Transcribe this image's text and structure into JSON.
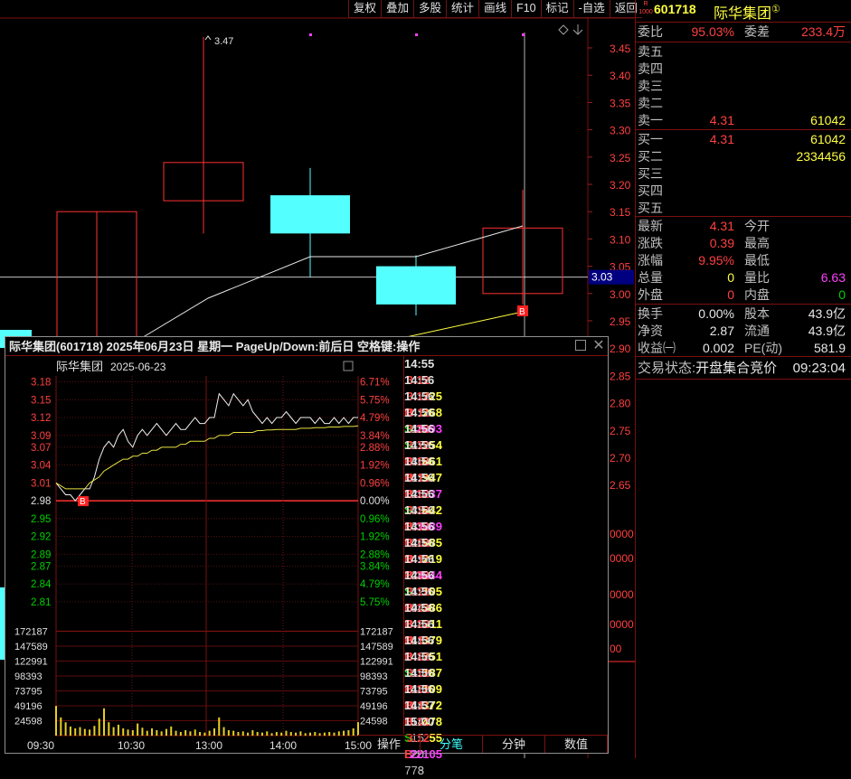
{
  "toolbar": [
    "复权",
    "叠加",
    "多股",
    "统计",
    "画线",
    "F10",
    "标记",
    "-自选",
    "返回"
  ],
  "main_chart": {
    "price_axis": [
      "3.45",
      "3.40",
      "3.35",
      "3.30",
      "3.25",
      "3.20",
      "3.15",
      "3.10",
      "3.05",
      "3.00",
      "2.95",
      "2.90",
      "2.85",
      "2.80",
      "2.75",
      "2.70",
      "2.65"
    ],
    "cursor_price": "3.03",
    "high_label": "3.47",
    "buy_marker": "B",
    "partial_right_labels": [
      "0000",
      "0000",
      "0000",
      "0000",
      "00"
    ],
    "candles": [
      {
        "open": 3.15,
        "close": 2.9,
        "high": 3.15,
        "low": 2.9,
        "color": "red"
      },
      {
        "open": 3.17,
        "close": 3.24,
        "high": 3.47,
        "low": 3.11,
        "color": "red"
      },
      {
        "open": 3.18,
        "close": 3.11,
        "high": 3.23,
        "low": 3.03,
        "color": "cyan"
      },
      {
        "open": 3.05,
        "close": 2.98,
        "high": 3.07,
        "low": 2.96,
        "color": "cyan"
      },
      {
        "open": 3.0,
        "close": 3.12,
        "high": 3.19,
        "low": 2.98,
        "color": "red"
      }
    ],
    "chart_data": {
      "type": "candlestick",
      "y_range": [
        2.6,
        3.5
      ]
    }
  },
  "quote": {
    "market": "R 1000",
    "code": "601718",
    "name": "际华集团",
    "badge": "①",
    "webi_label": "委比",
    "webi": "95.03%",
    "weicha_label": "委差",
    "weicha": "233.4万",
    "sell": [
      {
        "label": "卖五",
        "price": "",
        "vol": ""
      },
      {
        "label": "卖四",
        "price": "",
        "vol": ""
      },
      {
        "label": "卖三",
        "price": "",
        "vol": ""
      },
      {
        "label": "卖二",
        "price": "",
        "vol": ""
      },
      {
        "label": "卖一",
        "price": "4.31",
        "vol": "61042"
      }
    ],
    "buy": [
      {
        "label": "买一",
        "price": "4.31",
        "vol": "61042"
      },
      {
        "label": "买二",
        "price": "",
        "vol": "2334456"
      },
      {
        "label": "买三",
        "price": "",
        "vol": ""
      },
      {
        "label": "买四",
        "price": "",
        "vol": ""
      },
      {
        "label": "买五",
        "price": "",
        "vol": ""
      }
    ],
    "stats": [
      {
        "l1": "最新",
        "v1": "4.31",
        "c1": "red",
        "l2": "今开",
        "v2": "",
        "c2": "white"
      },
      {
        "l1": "涨跌",
        "v1": "0.39",
        "c1": "red",
        "l2": "最高",
        "v2": "",
        "c2": "white"
      },
      {
        "l1": "涨幅",
        "v1": "9.95%",
        "c1": "red",
        "l2": "最低",
        "v2": "",
        "c2": "white"
      },
      {
        "l1": "总量",
        "v1": "0",
        "c1": "yellow",
        "l2": "量比",
        "v2": "6.63",
        "c2": "mag"
      },
      {
        "l1": "外盘",
        "v1": "0",
        "c1": "red",
        "l2": "内盘",
        "v2": "0",
        "c2": "green"
      }
    ],
    "fin": [
      {
        "l1": "换手",
        "v1": "0.00%",
        "l2": "股本",
        "v2": "43.9亿"
      },
      {
        "l1": "净资",
        "v1": "2.87",
        "l2": "流通",
        "v2": "43.9亿"
      },
      {
        "l1": "收益㈠",
        "v1": "0.002",
        "l2": "PE(动)",
        "v2": "581.9"
      }
    ],
    "status_label": "交易状态:",
    "status_value": "开盘集合竞价",
    "status_time": "09:23:04"
  },
  "popup": {
    "title": "际华集团(601718) 2025年06月23日 星期一 PageUp/Down:前后日 空格键:操作",
    "inner_name": "际华集团",
    "inner_date": "2025-06-23",
    "left_axis": [
      "3.18",
      "3.15",
      "3.12",
      "3.09",
      "3.07",
      "3.04",
      "3.01",
      "2.98",
      "2.95",
      "2.92",
      "2.89",
      "2.87",
      "2.84",
      "2.81"
    ],
    "right_axis": [
      "6.71%",
      "5.75%",
      "4.79%",
      "3.84%",
      "2.88%",
      "1.92%",
      "0.96%",
      "0.00%",
      "0.96%",
      "1.92%",
      "2.88%",
      "3.84%",
      "4.79%",
      "5.75%"
    ],
    "vol_axis": [
      "172187",
      "147589",
      "122991",
      "98393",
      "73795",
      "49196",
      "24598"
    ],
    "time_axis": [
      "09:30",
      "10:30",
      "13:00",
      "14:00",
      "15:00"
    ],
    "buy_marker": "B",
    "chart_data": {
      "type": "line",
      "y_range": [
        2.79,
        3.19
      ],
      "prev_close": 2.98,
      "price": [
        3.01,
        3.0,
        2.99,
        2.99,
        2.98,
        2.99,
        3.0,
        3.0,
        3.02,
        3.05,
        3.07,
        3.08,
        3.07,
        3.09,
        3.1,
        3.08,
        3.07,
        3.09,
        3.1,
        3.09,
        3.1,
        3.11,
        3.1,
        3.09,
        3.1,
        3.11,
        3.1,
        3.1,
        3.11,
        3.12,
        3.11,
        3.11,
        3.12,
        3.12,
        3.16,
        3.15,
        3.14,
        3.16,
        3.15,
        3.14,
        3.15,
        3.13,
        3.12,
        3.11,
        3.12,
        3.11,
        3.12,
        3.12,
        3.13,
        3.12,
        3.11,
        3.12,
        3.12,
        3.12,
        3.11,
        3.12,
        3.11,
        3.11,
        3.12,
        3.11,
        3.12,
        3.11,
        3.12,
        3.12
      ],
      "avg": [
        3.01,
        3.005,
        3.0,
        3.0,
        3.0,
        3.0,
        3.0,
        3.01,
        3.015,
        3.02,
        3.03,
        3.035,
        3.04,
        3.045,
        3.05,
        3.05,
        3.055,
        3.055,
        3.06,
        3.06,
        3.065,
        3.065,
        3.07,
        3.07,
        3.07,
        3.07,
        3.075,
        3.075,
        3.08,
        3.08,
        3.08,
        3.08,
        3.085,
        3.085,
        3.09,
        3.09,
        3.09,
        3.095,
        3.095,
        3.095,
        3.095,
        3.095,
        3.098,
        3.098,
        3.099,
        3.099,
        3.1,
        3.1,
        3.1,
        3.1,
        3.1,
        3.102,
        3.102,
        3.102,
        3.103,
        3.103,
        3.103,
        3.104,
        3.104,
        3.104,
        3.105,
        3.105,
        3.105,
        3.106
      ],
      "volume": [
        49000,
        30000,
        22000,
        15000,
        12000,
        14000,
        11000,
        10000,
        16000,
        28000,
        45000,
        22000,
        14000,
        18000,
        12000,
        10000,
        9000,
        20000,
        13000,
        8000,
        12000,
        9000,
        7000,
        11000,
        15000,
        8000,
        6000,
        9000,
        7000,
        10000,
        6000,
        5000,
        8000,
        12000,
        30000,
        14000,
        9000,
        8000,
        6000,
        7000,
        5000,
        9000,
        6000,
        5000,
        7000,
        4000,
        6000,
        5000,
        8000,
        6000,
        5000,
        7000,
        4000,
        5000,
        6000,
        4000,
        5000,
        6000,
        5000,
        7000,
        8000,
        9000,
        12000,
        22105
      ]
    },
    "ticks": [
      {
        "t": "14:55",
        "p": "3.12",
        "v": "725",
        "bs": "B",
        "n": "13"
      },
      {
        "t": "14:56",
        "p": "3.12",
        "v": "268",
        "bs": "S",
        "n": "17"
      },
      {
        "t": "14:56",
        "p": "3.11",
        "v": "2893",
        "bs": "S",
        "n": "36"
      },
      {
        "t": "14:56",
        "p": "3.12",
        "v": "254",
        "bs": "B",
        "n": "12"
      },
      {
        "t": "14:56",
        "p": "3.12",
        "v": "861",
        "bs": "B",
        "n": "25"
      },
      {
        "t": "14:56",
        "p": "3.12",
        "v": "947",
        "bs": "B",
        "n": "33"
      },
      {
        "t": "14:56",
        "p": "3.11",
        "v": "1237",
        "bs": "S",
        "n": "32"
      },
      {
        "t": "14:56",
        "p": "3.12",
        "v": "642",
        "bs": "B",
        "n": "20"
      },
      {
        "t": "14:56",
        "p": "3.12",
        "v": "3089",
        "bs": "B",
        "n": "49"
      },
      {
        "t": "14:56",
        "p": "3.12",
        "v": "985",
        "bs": "B",
        "n": "28"
      },
      {
        "t": "14:56",
        "p": "3.12",
        "v": "219",
        "bs": "B",
        "n": "12"
      },
      {
        "t": "14:56",
        "p": "3.11",
        "v": "3844",
        "bs": "S",
        "n": "94"
      },
      {
        "t": "14:56",
        "p": "3.12",
        "v": "105",
        "bs": "B",
        "n": "8"
      },
      {
        "t": "14:56",
        "p": "3.12",
        "v": "386",
        "bs": "B",
        "n": "18"
      },
      {
        "t": "14:56",
        "p": "3.12",
        "v": "311",
        "bs": "B",
        "n": "8"
      },
      {
        "t": "14:56",
        "p": "3.12",
        "v": "379",
        "bs": "B",
        "n": "15"
      },
      {
        "t": "14:56",
        "p": "3.11",
        "v": "751",
        "bs": "S",
        "n": "18"
      },
      {
        "t": "14:56",
        "p": "3.12",
        "v": "187",
        "bs": "B",
        "n": "14"
      },
      {
        "t": "14:56",
        "p": "3.12",
        "v": "109",
        "bs": "B",
        "n": "14"
      },
      {
        "t": "14:56",
        "p": "3.12",
        "v": "372",
        "bs": "B",
        "n": "15"
      },
      {
        "t": "14:56",
        "p": "3.11",
        "v": "478",
        "bs": "S",
        "n": "20"
      },
      {
        "t": "14:57",
        "p": "3.12",
        "v": "55",
        "bs": "B",
        "n": "3"
      },
      {
        "t": "15:00",
        "p": "3.12",
        "v": "22105",
        "bs": "",
        "n": "778"
      }
    ],
    "tabs": [
      "操作",
      "分笔",
      "分钟",
      "数值"
    ]
  }
}
